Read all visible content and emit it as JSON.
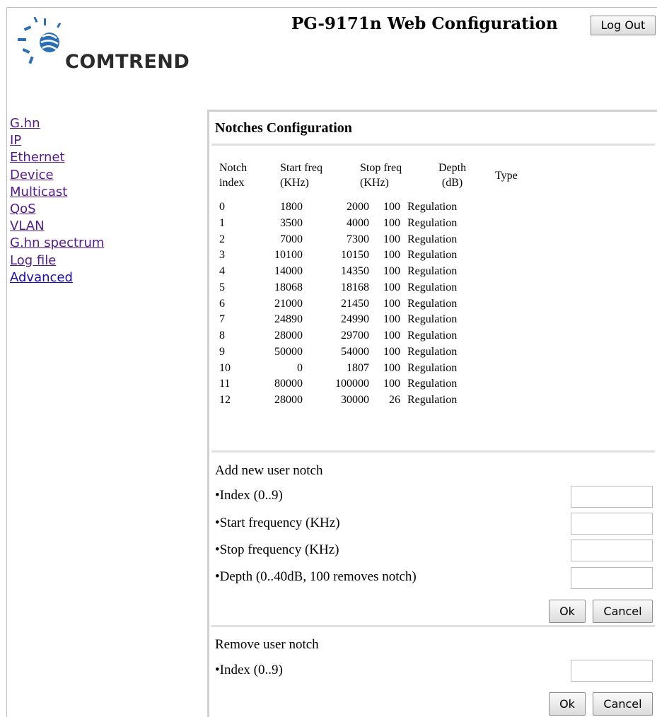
{
  "header": {
    "title": "PG-9171n Web Configuration",
    "logout_label": "Log Out",
    "brand": "COMTREND"
  },
  "sidebar": {
    "items": [
      {
        "label": "G.hn"
      },
      {
        "label": "IP"
      },
      {
        "label": "Ethernet"
      },
      {
        "label": "Device"
      },
      {
        "label": "Multicast"
      },
      {
        "label": "QoS"
      },
      {
        "label": "VLAN"
      },
      {
        "label": "G.hn spectrum"
      },
      {
        "label": "Log file"
      },
      {
        "label": "Advanced"
      }
    ]
  },
  "notches": {
    "heading": "Notches Configuration",
    "columns": {
      "index": [
        "Notch",
        "index"
      ],
      "start": [
        "Start freq",
        "(KHz)"
      ],
      "stop": [
        "Stop freq",
        "(KHz)"
      ],
      "depth": [
        "Depth",
        "(dB)"
      ],
      "type": "Type"
    },
    "rows": [
      {
        "index": "0",
        "start": "1800",
        "stop": "2000",
        "depth": "100",
        "type": "Regulation"
      },
      {
        "index": "1",
        "start": "3500",
        "stop": "4000",
        "depth": "100",
        "type": "Regulation"
      },
      {
        "index": "2",
        "start": "7000",
        "stop": "7300",
        "depth": "100",
        "type": "Regulation"
      },
      {
        "index": "3",
        "start": "10100",
        "stop": "10150",
        "depth": "100",
        "type": "Regulation"
      },
      {
        "index": "4",
        "start": "14000",
        "stop": "14350",
        "depth": "100",
        "type": "Regulation"
      },
      {
        "index": "5",
        "start": "18068",
        "stop": "18168",
        "depth": "100",
        "type": "Regulation"
      },
      {
        "index": "6",
        "start": "21000",
        "stop": "21450",
        "depth": "100",
        "type": "Regulation"
      },
      {
        "index": "7",
        "start": "24890",
        "stop": "24990",
        "depth": "100",
        "type": "Regulation"
      },
      {
        "index": "8",
        "start": "28000",
        "stop": "29700",
        "depth": "100",
        "type": "Regulation"
      },
      {
        "index": "9",
        "start": "50000",
        "stop": "54000",
        "depth": "100",
        "type": "Regulation"
      },
      {
        "index": "10",
        "start": "0",
        "stop": "1807",
        "depth": "100",
        "type": "Regulation"
      },
      {
        "index": "11",
        "start": "80000",
        "stop": "100000",
        "depth": "100",
        "type": "Regulation"
      },
      {
        "index": "12",
        "start": "28000",
        "stop": "30000",
        "depth": "26",
        "type": "Regulation"
      }
    ]
  },
  "add_notch": {
    "title": "Add new user notch",
    "index_label": "•Index (0..9)",
    "start_label": "•Start frequency (KHz)",
    "stop_label": "•Stop frequency (KHz)",
    "depth_label": "•Depth (0..40dB, 100 removes notch)",
    "index_value": "",
    "start_value": "",
    "stop_value": "",
    "depth_value": "",
    "ok_label": "Ok",
    "cancel_label": "Cancel"
  },
  "remove_notch": {
    "title": "Remove user notch",
    "index_label": "•Index (0..9)",
    "index_value": "",
    "ok_label": "Ok",
    "cancel_label": "Cancel"
  }
}
